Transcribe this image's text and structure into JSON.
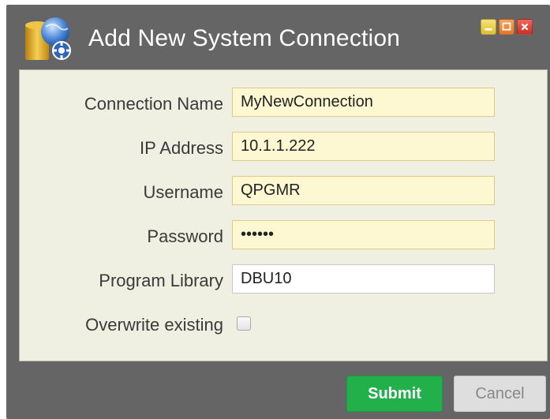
{
  "window": {
    "title": "Add New System Connection",
    "icons": {
      "app": "database-settings-icon",
      "minimize": "minimize-icon",
      "maximize": "maximize-icon",
      "close": "close-icon"
    }
  },
  "form": {
    "connection_name": {
      "label": "Connection Name",
      "value": "MyNewConnection"
    },
    "ip_address": {
      "label": "IP Address",
      "value": "10.1.1.222"
    },
    "username": {
      "label": "Username",
      "value": "QPGMR"
    },
    "password": {
      "label": "Password",
      "value": "••••••"
    },
    "program_library": {
      "label": "Program Library",
      "value": "DBU10"
    },
    "overwrite_existing": {
      "label": "Overwrite existing",
      "checked": false
    }
  },
  "buttons": {
    "submit": "Submit",
    "cancel": "Cancel"
  },
  "colors": {
    "window_bg": "#656565",
    "panel_bg": "#efefe2",
    "field_bg": "#fdf8d2",
    "submit_bg": "#22b04a",
    "cancel_bg": "#dedede"
  }
}
